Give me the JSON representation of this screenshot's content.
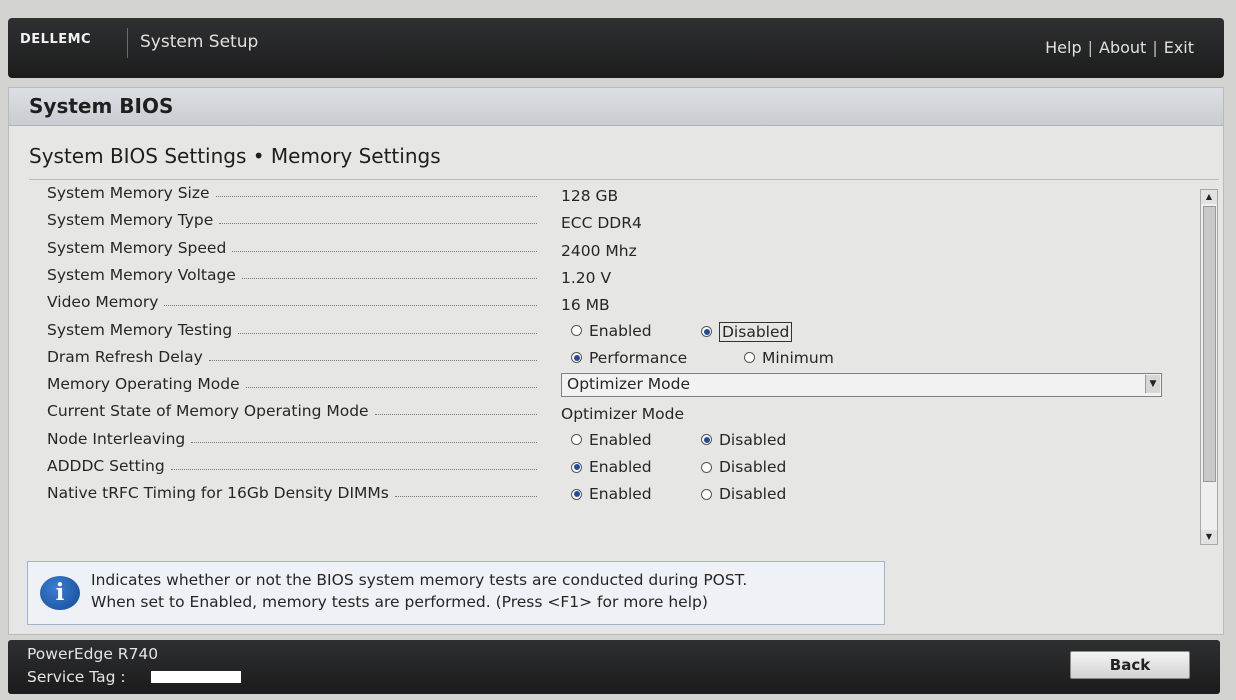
{
  "header": {
    "brand": "DELLEMC",
    "app_title": "System Setup",
    "links": {
      "help": "Help",
      "about": "About",
      "exit": "Exit"
    },
    "separator": "|"
  },
  "panel": {
    "title": "System BIOS",
    "breadcrumb": "System BIOS Settings • Memory Settings"
  },
  "settings": [
    {
      "label": "System Memory Size",
      "value": "128 GB"
    },
    {
      "label": "System Memory Type",
      "value": "ECC DDR4"
    },
    {
      "label": "System Memory Speed",
      "value": "2400 Mhz"
    },
    {
      "label": "System Memory Voltage",
      "value": "1.20 V"
    },
    {
      "label": "Video Memory",
      "value": "16 MB"
    },
    {
      "label": "System Memory Testing",
      "options": [
        "Enabled",
        "Disabled"
      ],
      "selected": "Disabled"
    },
    {
      "label": "Dram Refresh Delay",
      "options": [
        "Performance",
        "Minimum"
      ],
      "selected": "Performance"
    },
    {
      "label": "Memory Operating Mode",
      "dropdown": "Optimizer Mode"
    },
    {
      "label": "Current State of Memory Operating Mode",
      "value": "Optimizer Mode"
    },
    {
      "label": "Node Interleaving",
      "options": [
        "Enabled",
        "Disabled"
      ],
      "selected": "Disabled"
    },
    {
      "label": "ADDDC Setting",
      "options": [
        "Enabled",
        "Disabled"
      ],
      "selected": "Enabled"
    },
    {
      "label": "Native tRFC Timing for 16Gb Density DIMMs",
      "options": [
        "Enabled",
        "Disabled"
      ],
      "selected": "Enabled"
    }
  ],
  "help": {
    "icon": "info-icon",
    "line1": "Indicates whether or not the BIOS system memory tests are conducted during POST.",
    "line2": "When set to Enabled, memory tests are performed. (Press <F1> for more help)"
  },
  "footer": {
    "model": "PowerEdge R740",
    "service_tag_label": "Service Tag :",
    "back_label": "Back"
  },
  "colors": {
    "radio_selected": "#1f4e9a",
    "bar_dark": "#1c1c1d",
    "info_blue": "#124a97"
  }
}
